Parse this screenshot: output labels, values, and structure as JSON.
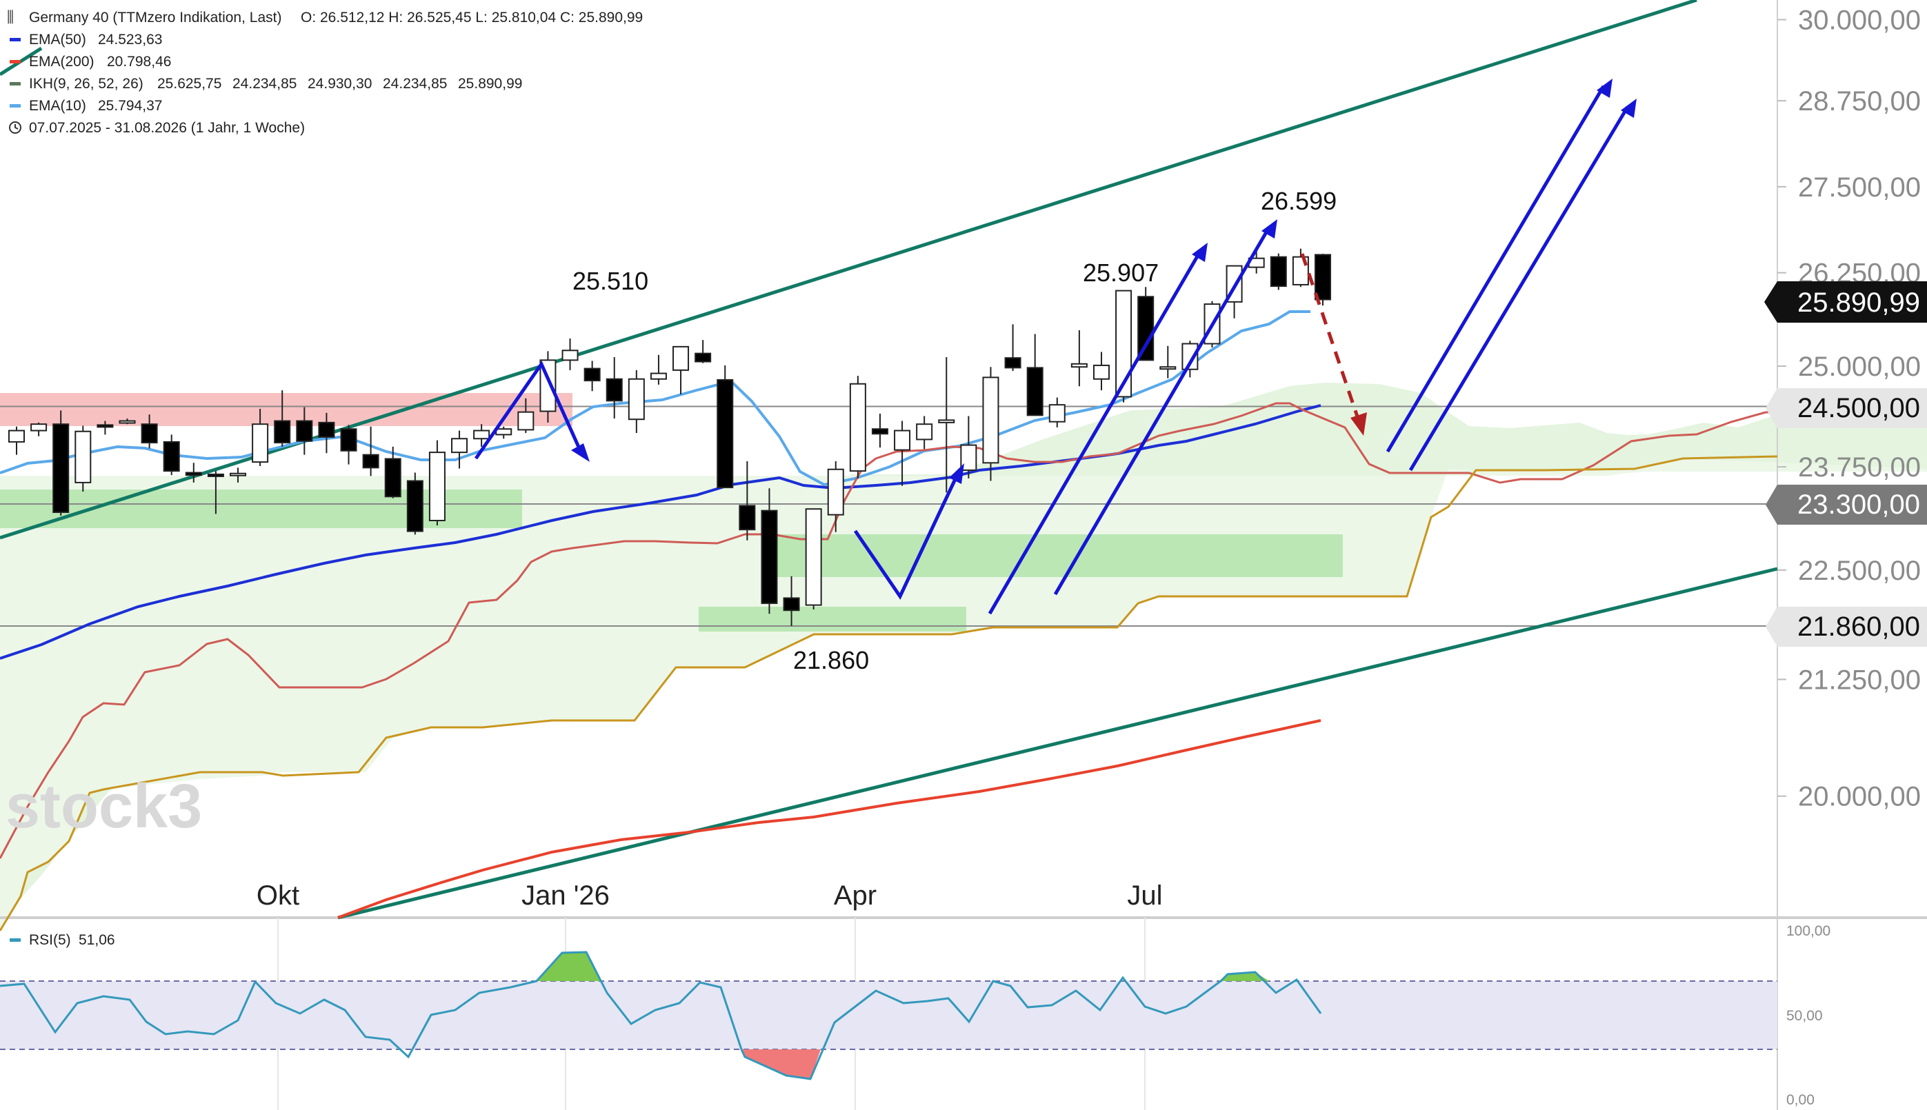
{
  "chart_data": {
    "type": "candlestick",
    "instrument": "Germany 40 (TTMzero Indikation, Last)",
    "ohlc_header": "O: 26.512,12  H: 26.525,45  L: 25.810,04  C: 25.890,99",
    "legend": [
      {
        "label": "EMA(50)",
        "value": "24.523,63",
        "color": "#1c2fd6"
      },
      {
        "label": "EMA(200)",
        "value": "20.798,46",
        "color": "#e8412c"
      },
      {
        "label": "IKH(9, 26, 52, 26)",
        "values": [
          "25.625,75",
          "24.234,85",
          "24.930,30",
          "24.234,85",
          "25.890,99"
        ],
        "colors": [
          "#3a8a3a",
          "#c8961e",
          "#cf5b55",
          "#c8961e",
          "#c0392b"
        ],
        "color": "#5a7a5a"
      },
      {
        "label": "EMA(10)",
        "value": "25.794,37",
        "color": "#5aa9ea"
      }
    ],
    "range_text": "07.07.2025 - 31.08.2026   (1 Jahr, 1 Woche)",
    "y_ticks": [
      "30.000,00",
      "28.750,00",
      "27.500,00",
      "26.250,00",
      "25.000,00",
      "23.750,00",
      "22.500,00",
      "21.250,00",
      "20.000,00"
    ],
    "y_tick_values": [
      30000,
      28750,
      27500,
      26250,
      25000,
      23750,
      22500,
      21250,
      20000
    ],
    "x_labels": [
      "Okt",
      "Jan '26",
      "Apr",
      "Jul"
    ],
    "last_price_label": "25.890,99",
    "level_labels": [
      "24.500,00",
      "23.300,00",
      "21.860,00"
    ],
    "levels": [
      24500,
      23300,
      21860
    ],
    "annotations": [
      "25.510",
      "25.907",
      "26.599",
      "21.860"
    ],
    "watermark": "stock3",
    "candles": [
      [
        24060,
        24250,
        23900,
        24200
      ],
      [
        24200,
        24300,
        24130,
        24280
      ],
      [
        24280,
        24450,
        23160,
        23200
      ],
      [
        23560,
        24260,
        23450,
        24190
      ],
      [
        24270,
        24320,
        24150,
        24250
      ],
      [
        24310,
        24350,
        24280,
        24320
      ],
      [
        24280,
        24400,
        23980,
        24050
      ],
      [
        24060,
        24150,
        23650,
        23700
      ],
      [
        23680,
        23800,
        23560,
        23650
      ],
      [
        23660,
        23700,
        23180,
        23640
      ],
      [
        23650,
        23740,
        23560,
        23670
      ],
      [
        23810,
        24470,
        23760,
        24280
      ],
      [
        24320,
        24700,
        24000,
        24050
      ],
      [
        24320,
        24490,
        23900,
        24070
      ],
      [
        24300,
        24420,
        23920,
        24120
      ],
      [
        24220,
        24270,
        23780,
        23950
      ],
      [
        23900,
        24250,
        23640,
        23740
      ],
      [
        23850,
        24000,
        23370,
        23390
      ],
      [
        23580,
        23680,
        22930,
        22970
      ],
      [
        23100,
        24080,
        23040,
        23930
      ],
      [
        23930,
        24200,
        23730,
        24100
      ],
      [
        24100,
        24280,
        24000,
        24200
      ],
      [
        24150,
        24250,
        24100,
        24220
      ],
      [
        24210,
        24600,
        24170,
        24430
      ],
      [
        24440,
        25200,
        24300,
        25080
      ],
      [
        25080,
        25370,
        24950,
        25210
      ],
      [
        24970,
        25070,
        24690,
        24820
      ],
      [
        24840,
        25120,
        24350,
        24570
      ],
      [
        24340,
        24950,
        24170,
        24840
      ],
      [
        24840,
        25150,
        24770,
        24910
      ],
      [
        24950,
        25140,
        24650,
        25260
      ],
      [
        25170,
        25350,
        25040,
        25060
      ],
      [
        24830,
        25010,
        23500,
        23500
      ],
      [
        23280,
        23820,
        22860,
        22990
      ],
      [
        23220,
        23490,
        22000,
        22120
      ],
      [
        22180,
        22430,
        21860,
        22040
      ],
      [
        22100,
        23220,
        22050,
        23240
      ],
      [
        23170,
        23820,
        22960,
        23720
      ],
      [
        23700,
        24880,
        23610,
        24780
      ],
      [
        24220,
        24410,
        23990,
        24160
      ],
      [
        23960,
        24320,
        23520,
        24200
      ],
      [
        24090,
        24380,
        23970,
        24280
      ],
      [
        24300,
        25120,
        23440,
        24330
      ],
      [
        23710,
        24380,
        23610,
        24020
      ],
      [
        23800,
        24990,
        23580,
        24860
      ],
      [
        25110,
        25560,
        24940,
        24980
      ],
      [
        24980,
        25430,
        24390,
        24390
      ],
      [
        24310,
        24610,
        24240,
        24520
      ],
      [
        24990,
        25480,
        24750,
        25030
      ],
      [
        24840,
        25190,
        24700,
        25010
      ],
      [
        24620,
        26010,
        24550,
        26010
      ],
      [
        25930,
        26060,
        25080,
        25080
      ],
      [
        24970,
        25270,
        24850,
        24990
      ],
      [
        24960,
        25340,
        24860,
        25300
      ],
      [
        25300,
        25870,
        25250,
        25830
      ],
      [
        25860,
        26340,
        25640,
        26350
      ],
      [
        26330,
        26570,
        26240,
        26460
      ],
      [
        26480,
        26530,
        26020,
        26070
      ],
      [
        26090,
        26600,
        26060,
        26480
      ],
      [
        26512.12,
        26525.45,
        25810.04,
        25890.99
      ]
    ]
  }
}
